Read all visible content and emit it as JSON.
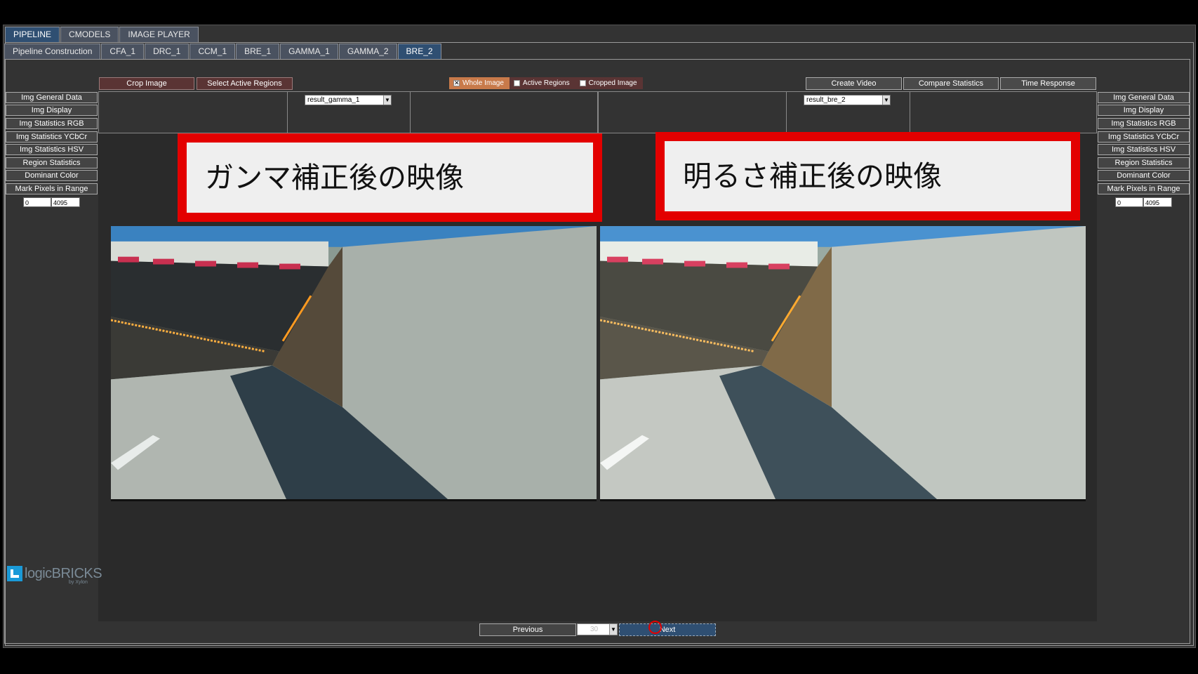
{
  "main_tabs": [
    {
      "label": "PIPELINE",
      "active": true
    },
    {
      "label": "CMODELS",
      "active": false
    },
    {
      "label": "IMAGE PLAYER",
      "active": false
    }
  ],
  "sub_tabs": [
    {
      "label": "Pipeline Construction",
      "active": false
    },
    {
      "label": "CFA_1",
      "active": false
    },
    {
      "label": "DRC_1",
      "active": false
    },
    {
      "label": "CCM_1",
      "active": false
    },
    {
      "label": "BRE_1",
      "active": false
    },
    {
      "label": "GAMMA_1",
      "active": false
    },
    {
      "label": "GAMMA_2",
      "active": false
    },
    {
      "label": "BRE_2",
      "active": true
    }
  ],
  "toolbar": {
    "crop_image": "Crop Image",
    "select_active_regions": "Select Active Regions",
    "create_video": "Create Video",
    "compare_statistics": "Compare Statistics",
    "time_response": "Time Response"
  },
  "view_options": [
    {
      "label": "Whole Image",
      "checked": true
    },
    {
      "label": "Active Regions",
      "checked": false
    },
    {
      "label": "Cropped Image",
      "checked": false
    }
  ],
  "side_menu": [
    "Img General Data",
    "Img Display",
    "Img Statistics RGB",
    "Img Statistics YCbCr",
    "Img Statistics HSV",
    "Region Statistics",
    "Dominant Color",
    "Mark Pixels in Range"
  ],
  "range": {
    "min": "0",
    "max": "4095"
  },
  "left_view": {
    "dropdown": "result_gamma_1",
    "annotation": "ガンマ補正後の映像"
  },
  "right_view": {
    "dropdown": "result_bre_2",
    "annotation": "明るさ補正後の映像"
  },
  "logo": {
    "name": "logicBRICKS",
    "tagline": "by Xylon"
  },
  "navigation": {
    "previous": "Previous",
    "page": "30",
    "next": "Next"
  },
  "colors": {
    "annotation_border": "#e30000",
    "active_tab": "#2f4f72",
    "active_option": "#c87a4a"
  },
  "icons": {
    "dropdown": "chevron-down-icon",
    "checkbox": "check-icon",
    "cursor_marker": "red-circle-marker"
  }
}
